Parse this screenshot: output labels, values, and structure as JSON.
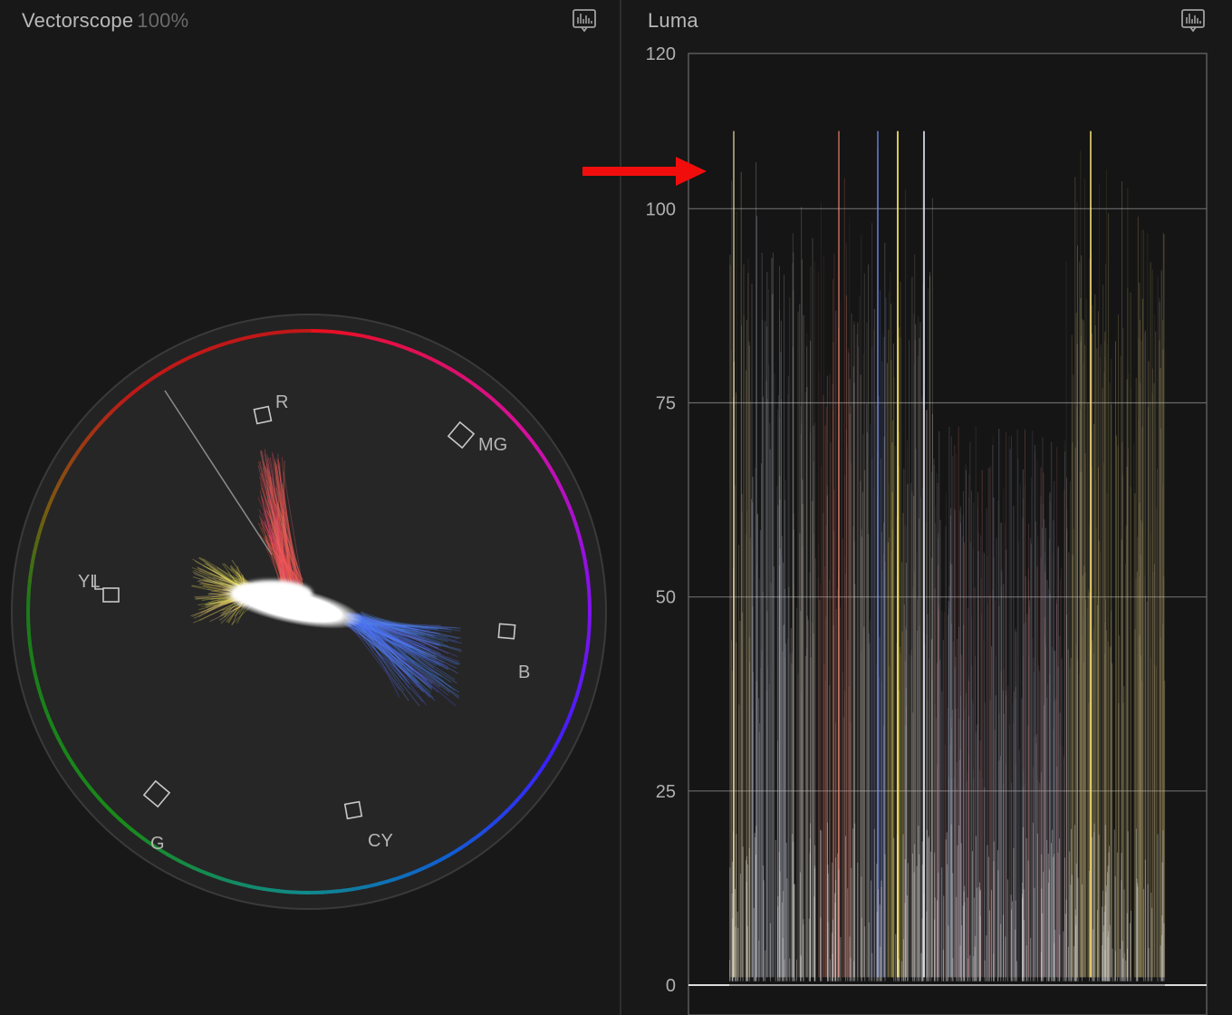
{
  "vectorscope": {
    "title": "Vectorscope",
    "zoom": "100%",
    "settings_icon": "scope-settings-icon",
    "targets": [
      {
        "key": "r",
        "label": "R"
      },
      {
        "key": "mg",
        "label": "MG"
      },
      {
        "key": "b",
        "label": "B"
      },
      {
        "key": "cy",
        "label": "CY"
      },
      {
        "key": "g",
        "label": "G"
      },
      {
        "key": "yl",
        "label": "YL"
      }
    ]
  },
  "luma": {
    "title": "Luma",
    "settings_icon": "scope-settings-icon",
    "scale_labels": [
      "120",
      "100",
      "75",
      "50",
      "25",
      "0"
    ],
    "chart_data": {
      "type": "waveform",
      "ylim": [
        0,
        120
      ],
      "y_ticks": [
        0,
        25,
        50,
        75,
        100,
        120
      ],
      "grid": true,
      "peak_value": 110
    }
  },
  "annotation": {
    "type": "arrow",
    "color": "#ff0000",
    "direction": "right"
  }
}
